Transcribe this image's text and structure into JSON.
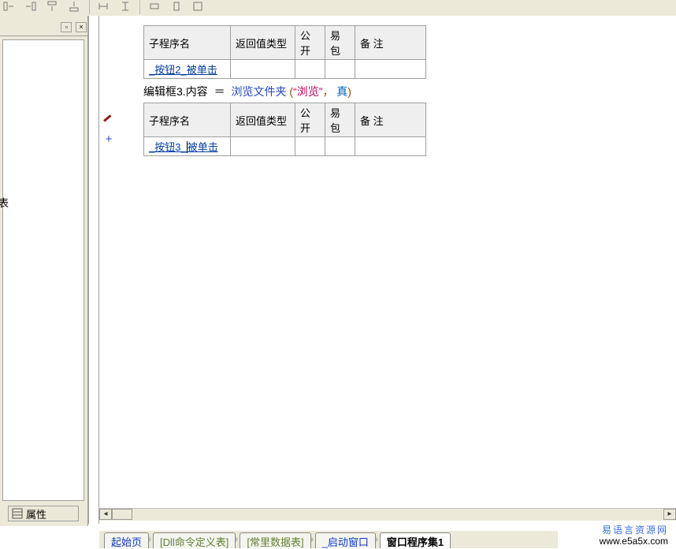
{
  "panel": {
    "properties_label": "属性"
  },
  "headers": {
    "name": "子程序名",
    "ret": "返回值类型",
    "pub": "公开",
    "pkg": "易包",
    "note": "备 注"
  },
  "sub1": {
    "name": "_按钮2_被单击"
  },
  "code": {
    "obj": "编辑框3.",
    "prop": "内容",
    "assign": "＝",
    "call": "浏览文件夹",
    "lparen": "(",
    "quote_l": "“",
    "str": "浏览",
    "quote_r": "”",
    "comma": "，",
    "bool": "真",
    "rparen": ")"
  },
  "sub2": {
    "name_a": "_按钮3_",
    "name_b": "被单击"
  },
  "tabs": {
    "start": "起始页",
    "dll": "[Dll命令定义表]",
    "const": "[常里数据表]",
    "boot": "_启动窗口",
    "cur": "窗口程序集1"
  },
  "watermark": {
    "line1": "易语言资源网",
    "line2": "www.e5a5x.com"
  },
  "side_char": "表"
}
